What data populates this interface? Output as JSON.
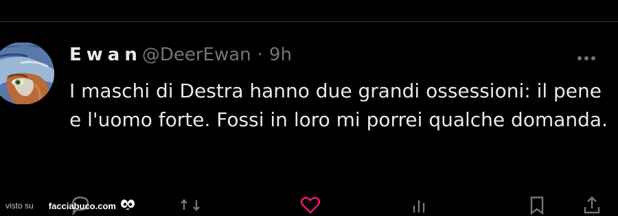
{
  "tweet": {
    "display_name": "Ewan",
    "handle": "@DeerEwan",
    "separator": "·",
    "time": "9h",
    "more_icon": "more-horizontal-icon",
    "text": "I maschi di Destra hanno due grandi ossessioni: il pene e l'uomo forte. Fossi in loro mi porrei qualche domanda."
  },
  "actions": [
    {
      "name": "reply-icon"
    },
    {
      "name": "retweet-icon"
    },
    {
      "name": "like-icon"
    },
    {
      "name": "views-icon"
    },
    {
      "name": "bookmark-icon"
    },
    {
      "name": "share-icon"
    }
  ],
  "watermark": {
    "prefix": "visto su",
    "brand": "facciabuco.com"
  },
  "colors": {
    "background": "#000000",
    "text_primary": "#e7e9ea",
    "text_secondary": "#71767b",
    "divider": "#2f3336",
    "retweet": "#00ba7c",
    "like": "#f91880"
  }
}
